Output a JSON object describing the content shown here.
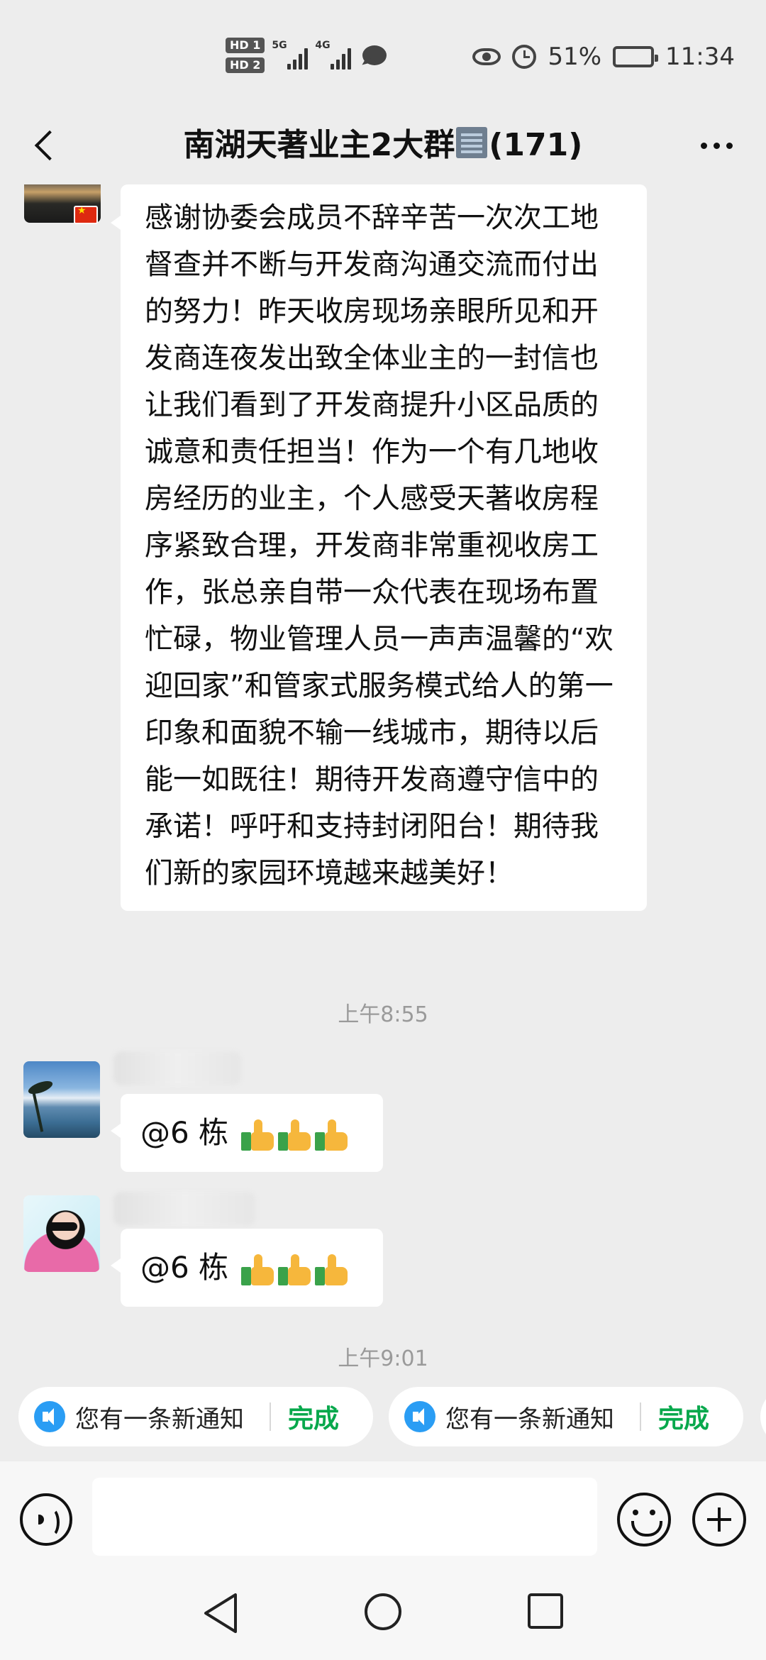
{
  "status_bar": {
    "hd1": "HD 1",
    "hd2": "HD 2",
    "net1": "5G",
    "net2": "4G",
    "battery_percent": "51%",
    "battery_level": 0.51,
    "time": "11:34",
    "icons": [
      "eye-icon",
      "alarm-icon",
      "battery-icon",
      "message-icon"
    ]
  },
  "header": {
    "title_before": "南湖天著业主2大群",
    "title_emoji": "office-building-emoji",
    "title_count": "(171)",
    "back_icon": "back-chevron-icon",
    "more_icon": "more-dots-icon"
  },
  "messages": [
    {
      "type": "text",
      "text": "感谢协委会成员不辞辛苦一次次工地督查并不断与开发商沟通交流而付出的努力！昨天收房现场亲眼所见和开发商连夜发出致全体业主的一封信也让我们看到了开发商提升小区品质的诚意和责任担当！作为一个有几地收房经历的业主，个人感受天著收房程序紧致合理，开发商非常重视收房工作，张总亲自带一众代表在现场布置忙碌，物业管理人员一声声温馨的“欢迎回家”和管家式服务模式给人的第一印象和面貌不输一线城市，期待以后能一如既往！期待开发商遵守信中的承诺！呼吁和支持封闭阳台！期待我们新的家园环境越来越美好！"
    },
    {
      "type": "timestamp",
      "text": "上午8:55"
    },
    {
      "type": "text",
      "text": "@6 栋",
      "emoji": "thumbs-up x3"
    },
    {
      "type": "text",
      "text": "@6 栋",
      "emoji": "thumbs-up x3"
    },
    {
      "type": "timestamp",
      "text": "上午9:01"
    }
  ],
  "notifications": [
    {
      "text": "您有一条新通知",
      "action": "完成"
    },
    {
      "text": "您有一条新通知",
      "action": "完成"
    }
  ],
  "input_bar": {
    "placeholder": "",
    "icons": [
      "voice-icon",
      "emoji-icon",
      "plus-icon"
    ]
  },
  "nav_bar": {
    "icons": [
      "nav-back-icon",
      "nav-home-icon",
      "nav-recent-icon"
    ]
  },
  "colors": {
    "background": "#ededed",
    "bubble": "#ffffff",
    "accent_green": "#07a84c",
    "speaker_blue": "#2a9df4"
  }
}
